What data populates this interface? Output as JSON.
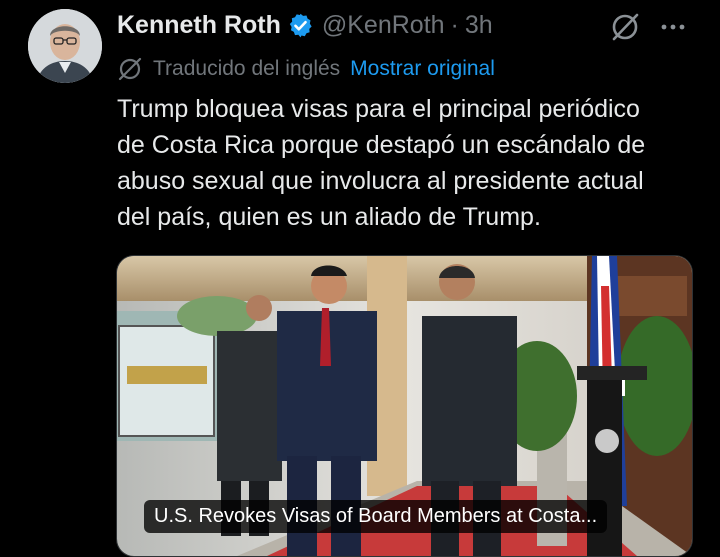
{
  "tweet": {
    "author_name": "Kenneth Roth",
    "handle": "@KenRoth",
    "separator": "·",
    "time": "3h",
    "translated_label": "Traducido del inglés",
    "show_original": "Mostrar original",
    "text": "Trump bloquea visas para el principal periódico\nde Costa Rica porque destapó un escándalo de\nabuso sexual que involucra al presidente actual\ndel país, quien es un aliado de Trump.",
    "link_card": {
      "caption": "U.S. Revokes Visas of Board Members at Costa..."
    }
  },
  "icons": {
    "verified": "verified-badge-icon",
    "grok": "grok-icon",
    "more": "more-icon",
    "translate": "translate-icon"
  },
  "colors": {
    "background": "#000000",
    "text_primary": "#e7e9ea",
    "text_secondary": "#71767b",
    "accent": "#1d9bf0"
  }
}
